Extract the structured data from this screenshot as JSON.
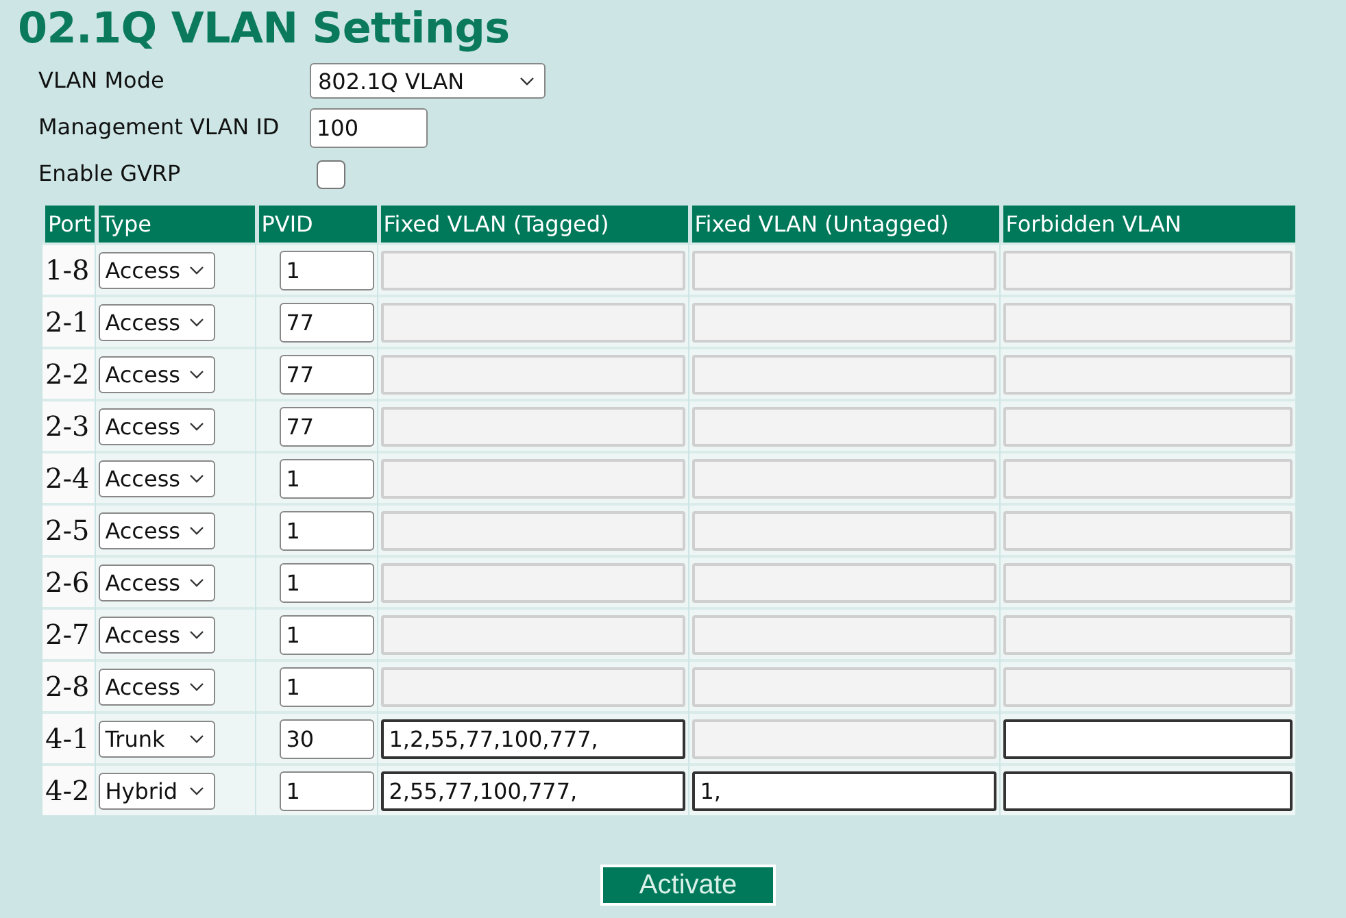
{
  "title": "02.1Q VLAN Settings",
  "settings": {
    "vlan_mode": {
      "label": "VLAN Mode",
      "value": "802.1Q VLAN"
    },
    "management_vlan_id": {
      "label": "Management VLAN ID",
      "value": "100"
    },
    "enable_gvrp": {
      "label": "Enable GVRP",
      "checked": false
    }
  },
  "table": {
    "columns": [
      "Port",
      "Type",
      "PVID",
      "Fixed VLAN (Tagged)",
      "Fixed VLAN (Untagged)",
      "Forbidden VLAN"
    ],
    "rows": [
      {
        "port": "1-8",
        "type": "Access",
        "pvid": "1",
        "tagged": {
          "disabled": true
        },
        "untagged": {
          "disabled": true
        },
        "forbidden": {
          "disabled": true
        }
      },
      {
        "port": "2-1",
        "type": "Access",
        "pvid": "77",
        "tagged": {
          "disabled": true
        },
        "untagged": {
          "disabled": true
        },
        "forbidden": {
          "disabled": true
        }
      },
      {
        "port": "2-2",
        "type": "Access",
        "pvid": "77",
        "tagged": {
          "disabled": true
        },
        "untagged": {
          "disabled": true
        },
        "forbidden": {
          "disabled": true
        }
      },
      {
        "port": "2-3",
        "type": "Access",
        "pvid": "77",
        "tagged": {
          "disabled": true
        },
        "untagged": {
          "disabled": true
        },
        "forbidden": {
          "disabled": true
        }
      },
      {
        "port": "2-4",
        "type": "Access",
        "pvid": "1",
        "tagged": {
          "disabled": true
        },
        "untagged": {
          "disabled": true
        },
        "forbidden": {
          "disabled": true
        }
      },
      {
        "port": "2-5",
        "type": "Access",
        "pvid": "1",
        "tagged": {
          "disabled": true
        },
        "untagged": {
          "disabled": true
        },
        "forbidden": {
          "disabled": true
        }
      },
      {
        "port": "2-6",
        "type": "Access",
        "pvid": "1",
        "tagged": {
          "disabled": true
        },
        "untagged": {
          "disabled": true
        },
        "forbidden": {
          "disabled": true
        }
      },
      {
        "port": "2-7",
        "type": "Access",
        "pvid": "1",
        "tagged": {
          "disabled": true
        },
        "untagged": {
          "disabled": true
        },
        "forbidden": {
          "disabled": true
        }
      },
      {
        "port": "2-8",
        "type": "Access",
        "pvid": "1",
        "tagged": {
          "disabled": true
        },
        "untagged": {
          "disabled": true
        },
        "forbidden": {
          "disabled": true
        }
      },
      {
        "port": "4-1",
        "type": "Trunk",
        "pvid": "30",
        "tagged": {
          "value": "1,2,55,77,100,777,",
          "disabled": false
        },
        "untagged": {
          "disabled": true
        },
        "forbidden": {
          "disabled": false
        }
      },
      {
        "port": "4-2",
        "type": "Hybrid",
        "pvid": "1",
        "tagged": {
          "value": "2,55,77,100,777,",
          "disabled": false
        },
        "untagged": {
          "value": "1,",
          "disabled": false
        },
        "forbidden": {
          "disabled": false
        }
      }
    ]
  },
  "activate_button": "Activate"
}
